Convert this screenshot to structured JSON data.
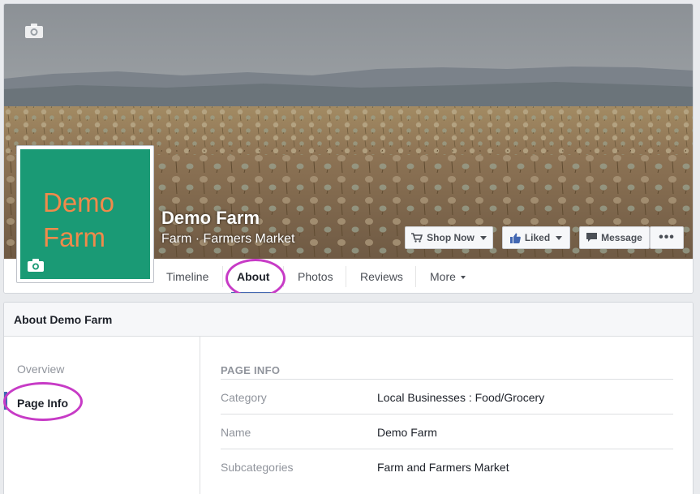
{
  "page": {
    "name": "Demo Farm",
    "categories": "Farm · Farmers Market",
    "profile_line1": "Demo",
    "profile_line2": "Farm"
  },
  "actions": {
    "shop_now": "Shop Now",
    "liked": "Liked",
    "message": "Message",
    "more": "•••"
  },
  "nav": {
    "tabs": [
      {
        "label": "Timeline"
      },
      {
        "label": "About"
      },
      {
        "label": "Photos"
      },
      {
        "label": "Reviews"
      },
      {
        "label": "More"
      }
    ],
    "active": "About"
  },
  "about": {
    "header": "About Demo Farm",
    "sidebar": [
      {
        "label": "Overview"
      },
      {
        "label": "Page Info"
      }
    ],
    "sidebar_active": "Page Info",
    "section_title": "PAGE INFO",
    "rows": [
      {
        "label": "Category",
        "value": "Local Businesses : Food/Grocery"
      },
      {
        "label": "Name",
        "value": "Demo Farm"
      },
      {
        "label": "Subcategories",
        "value": "Farm and Farmers Market"
      }
    ]
  },
  "colors": {
    "accent": "#4267b2",
    "highlight_circle": "#c73bc6",
    "profile_bg": "#1a9a75",
    "profile_text": "#f08a4b"
  },
  "icons": {
    "cover_camera": "camera-icon",
    "profile_camera": "camera-icon",
    "shop": "cart-icon",
    "liked": "thumbs-up-icon",
    "message": "chat-bubble-icon"
  }
}
